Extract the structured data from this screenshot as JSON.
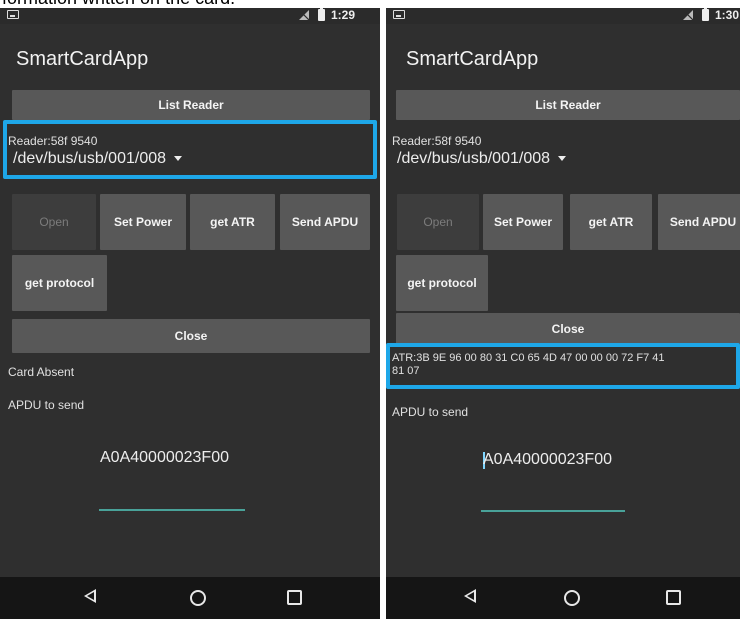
{
  "caption": "formation written on the card.",
  "left": {
    "status": {
      "time": "1:29"
    },
    "app_title": "SmartCardApp",
    "list_reader": "List Reader",
    "reader_label": "Reader:58f 9540",
    "reader_device": "/dev/bus/usb/001/008",
    "buttons": {
      "open": "Open",
      "set_power": "Set Power",
      "get_atr": "get ATR",
      "send_apdu": "Send APDU",
      "get_protocol": "get protocol",
      "close": "Close"
    },
    "card_status": "Card Absent",
    "apdu_label": "APDU to send",
    "apdu_value": "A0A40000023F00"
  },
  "right": {
    "status": {
      "time": "1:30"
    },
    "app_title": "SmartCardApp",
    "list_reader": "List Reader",
    "reader_label": "Reader:58f 9540",
    "reader_device": "/dev/bus/usb/001/008",
    "buttons": {
      "open": "Open",
      "set_power": "Set Power",
      "get_atr": "get ATR",
      "send_apdu": "Send APDU",
      "get_protocol": "get protocol",
      "close": "Close"
    },
    "atr_line1": "ATR:3B 9E 96 00 80 31 C0 65 4D 47 00 00 00 72 F7 41",
    "atr_line2": "81 07",
    "apdu_label": "APDU to send",
    "apdu_value": "A0A40000023F00"
  },
  "colors": {
    "highlight": "#1ea7e8",
    "underline": "#4db6ac",
    "background": "#2f2f2f"
  },
  "icons": [
    "notification-icon",
    "no-sim-icon",
    "battery-icon",
    "back-icon",
    "home-icon",
    "recents-icon"
  ]
}
